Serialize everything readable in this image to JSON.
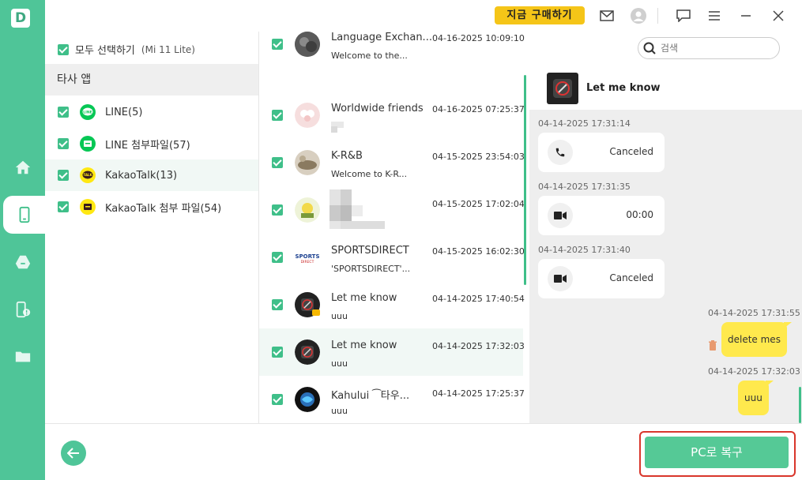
{
  "app": {
    "logo_letter": "D"
  },
  "topbar": {
    "buy_label": "지금 구매하기"
  },
  "search": {
    "placeholder": "검색"
  },
  "type_panel": {
    "select_all_label": "모두 선택하기",
    "device": "(Mi 11 Lite)",
    "section_title": "타사 앱",
    "items": [
      {
        "label": "LINE(5)",
        "icon": "line-icon",
        "color": "#06c755"
      },
      {
        "label": "LINE 첨부파일(57)",
        "icon": "line-attachment-icon",
        "color": "#06c755"
      },
      {
        "label": "KakaoTalk(13)",
        "icon": "kakaotalk-icon",
        "color": "#ffe812"
      },
      {
        "label": "KakaoTalk 첨부 파일(54)",
        "icon": "kakaotalk-attachment-icon",
        "color": "#ffe812"
      }
    ]
  },
  "conversations": [
    {
      "name": "Language Exchan...",
      "preview": "Welcome to the...",
      "time": "04-16-2025 10:09:10"
    },
    {
      "name": "Worldwide friends",
      "preview": "",
      "time": "04-16-2025 07:25:37"
    },
    {
      "name": "K-R&B",
      "preview": "Welcome to K-R...",
      "time": "04-15-2025 23:54:03"
    },
    {
      "name": "",
      "preview": "",
      "time": "04-15-2025 17:02:04"
    },
    {
      "name": "SPORTSDIRECT",
      "preview": "'SPORTSDIRECT'...",
      "time": "04-15-2025 16:02:30"
    },
    {
      "name": "Let me know",
      "preview": "uuu",
      "time": "04-14-2025 17:40:54"
    },
    {
      "name": "Let me know",
      "preview": "uuu",
      "time": "04-14-2025 17:32:03"
    },
    {
      "name": "Kahului ⁀타우...",
      "preview": "uuu",
      "time": "04-14-2025 17:25:37"
    }
  ],
  "chat": {
    "title": "Let me know",
    "messages": [
      {
        "time": "04-14-2025 17:31:14",
        "type": "voice-call",
        "text": "Canceled"
      },
      {
        "time": "04-14-2025 17:31:35",
        "type": "video-call",
        "text": "00:00"
      },
      {
        "time": "04-14-2025 17:31:40",
        "type": "video-call",
        "text": "Canceled"
      },
      {
        "time": "04-14-2025 17:31:55",
        "type": "sent",
        "text": "delete mes"
      },
      {
        "time": "04-14-2025 17:32:03",
        "type": "sent",
        "text": "uuu"
      }
    ]
  },
  "bottom": {
    "restore_label": "PC로 복구"
  },
  "colors": {
    "accent": "#4fc598",
    "highlight": "#d9362b",
    "buy": "#f5c518",
    "bubble": "#ffe94d"
  }
}
